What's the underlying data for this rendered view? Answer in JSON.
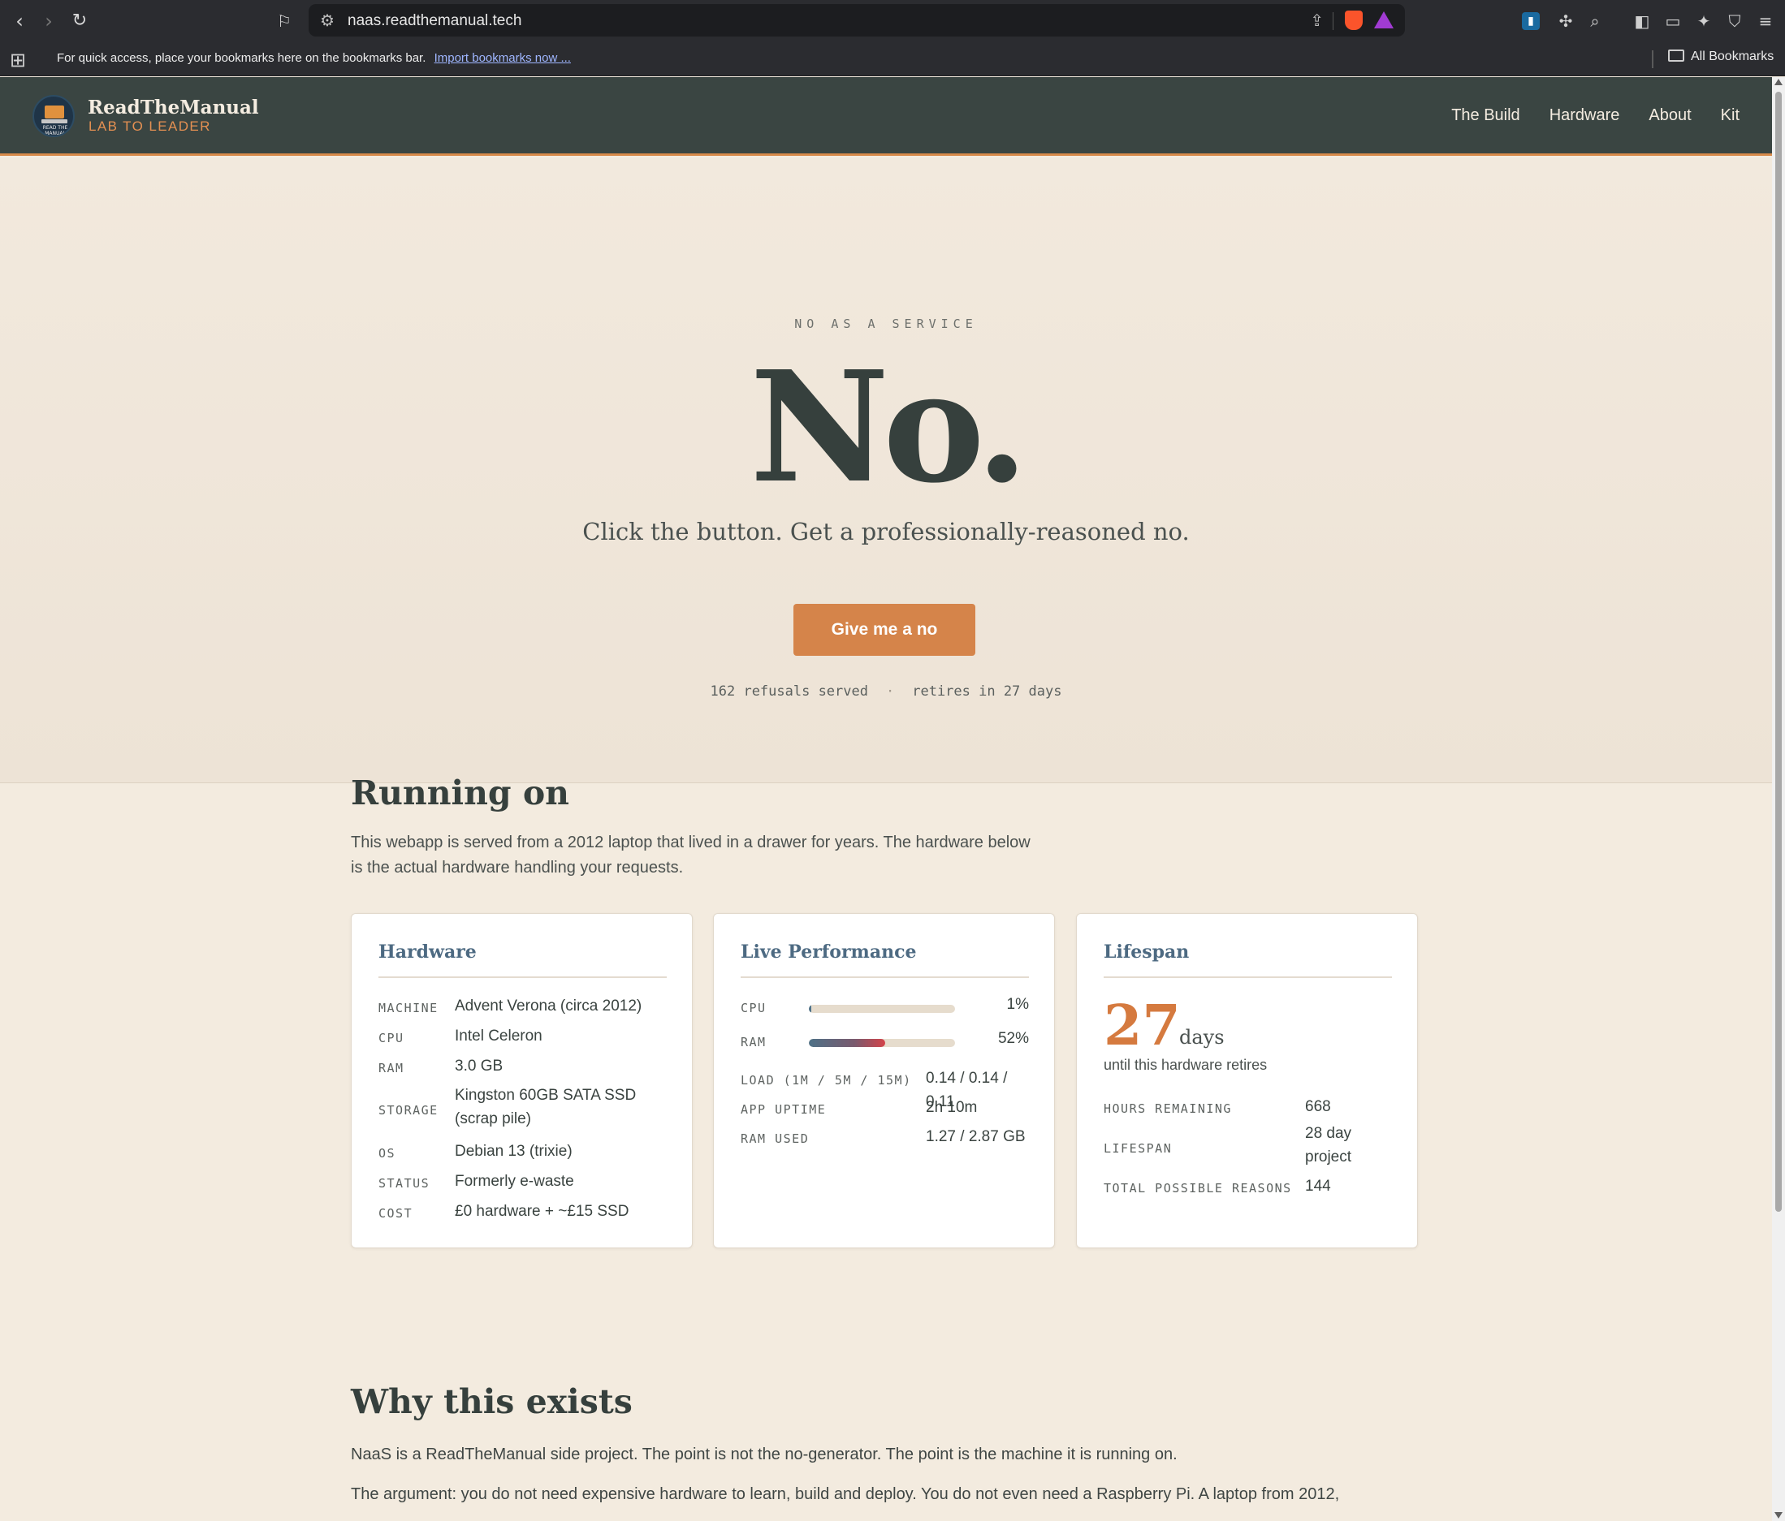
{
  "browser": {
    "url": "naas.readthemanual.tech",
    "bookmarks_bar": {
      "message": "For quick access, place your bookmarks here on the bookmarks bar.",
      "import_link": "Import bookmarks now ...",
      "all_bookmarks": "All Bookmarks"
    }
  },
  "site": {
    "brand_name": "ReadTheManual",
    "brand_tagline": "LAB TO LEADER",
    "logo_text": "READ THE MANUAL",
    "nav": [
      "The Build",
      "Hardware",
      "About",
      "Kit"
    ]
  },
  "hero": {
    "eyebrow": "NO AS A SERVICE",
    "title": "No.",
    "subtitle": "Click the button. Get a professionally-reasoned no.",
    "cta_label": "Give me a no",
    "refusals": "162 refusals served",
    "dot": "·",
    "retires": "retires in 27 days"
  },
  "running_on": {
    "heading": "Running on",
    "lead": "This webapp is served from a 2012 laptop that lived in a drawer for years. The hardware below is the actual hardware handling your requests.",
    "hardware": {
      "title": "Hardware",
      "rows": [
        {
          "k": "MACHINE",
          "v": "Advent Verona (circa 2012)"
        },
        {
          "k": "CPU",
          "v": "Intel Celeron"
        },
        {
          "k": "RAM",
          "v": "3.0 GB"
        },
        {
          "k": "STORAGE",
          "v": "Kingston 60GB SATA SSD (scrap pile)"
        },
        {
          "k": "OS",
          "v": "Debian 13 (trixie)"
        },
        {
          "k": "STATUS",
          "v": "Formerly e-waste"
        },
        {
          "k": "COST",
          "v": "£0 hardware + ~£15 SSD"
        }
      ]
    },
    "performance": {
      "title": "Live Performance",
      "cpu_label": "CPU",
      "cpu_percent": 1,
      "cpu_text": "1%",
      "ram_label": "RAM",
      "ram_percent": 52,
      "ram_text": "52%",
      "rows": [
        {
          "k": "LOAD (1M / 5M / 15M)",
          "v": "0.14 / 0.14 / 0.11"
        },
        {
          "k": "APP UPTIME",
          "v": "2h 10m"
        },
        {
          "k": "RAM USED",
          "v": "1.27 / 2.87 GB"
        }
      ]
    },
    "lifespan": {
      "title": "Lifespan",
      "days_number": "27",
      "days_unit": "days",
      "caption": "until this hardware retires",
      "rows": [
        {
          "k": "HOURS REMAINING",
          "v": "668"
        },
        {
          "k": "LIFESPAN",
          "v": "28 day project"
        },
        {
          "k": "TOTAL POSSIBLE REASONS",
          "v": "144"
        }
      ]
    }
  },
  "why": {
    "heading": "Why this exists",
    "p1": "NaaS is a ReadTheManual side project. The point is not the no-generator. The point is the machine it is running on.",
    "p2": "The argument: you do not need expensive hardware to learn, build and deploy. You do not even need a Raspberry Pi. A laptop from 2012,"
  },
  "colors": {
    "header_bg": "#3a4542",
    "accent_orange": "#d5844a",
    "card_title_blue": "#4d6a82"
  }
}
